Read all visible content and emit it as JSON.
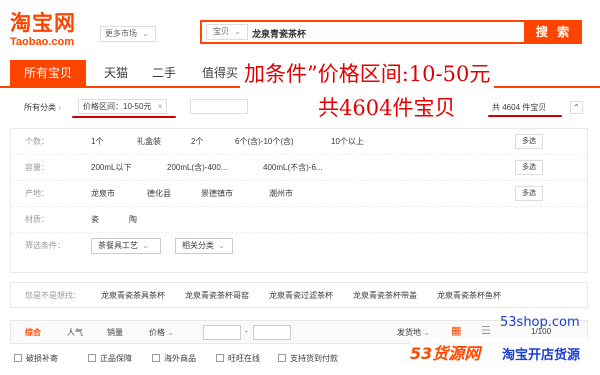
{
  "header": {
    "logo_cn": "淘宝网",
    "logo_en": "Taobao.com",
    "more_market": "更多市场",
    "search_category": "宝贝",
    "search_value": "龙泉青瓷茶杯",
    "search_button": "搜 索"
  },
  "tabs": [
    "所有宝贝",
    "天猫",
    "二手",
    "值得买"
  ],
  "overlay": {
    "line1": "加条件”价格区间:10-50元",
    "line2": "共4604件宝贝"
  },
  "breadcrumb": {
    "root": "所有分类",
    "price_tag": "价格区间：10-50元",
    "close": "×",
    "result_count": "共 4604 件宝贝"
  },
  "filters": [
    {
      "label": "个数：",
      "options": [
        "1个",
        "礼盒装",
        "2个",
        "6个(含)-10个(含)",
        "10个以上"
      ],
      "multi": "多选"
    },
    {
      "label": "容量：",
      "options": [
        "200mL以下",
        "200mL(含)-400...",
        "400mL(不含)-6..."
      ],
      "multi": "多选"
    },
    {
      "label": "产地：",
      "options": [
        "龙泉市",
        "德化县",
        "景德镇市",
        "潮州市"
      ],
      "multi": "多选"
    },
    {
      "label": "材质：",
      "options": [
        "瓷",
        "陶"
      ],
      "multi": ""
    },
    {
      "label": "筛选条件：",
      "options": [
        "茶餐具工艺",
        "相关分类"
      ],
      "multi": ""
    }
  ],
  "suggestions": {
    "label": "您是不是想找：",
    "items": [
      "龙泉青瓷茶具茶杯",
      "龙泉青瓷茶杯哥窑",
      "龙泉青瓷过滤茶杯",
      "龙泉青瓷茶杯带盖",
      "龙泉青瓷茶杯鱼杯"
    ]
  },
  "sort": {
    "items": [
      "综合",
      "人气",
      "销量",
      "价格"
    ],
    "dash": "-",
    "ship_to": "发货地",
    "page": "1/100"
  },
  "checks": [
    "破损补寄",
    "正品保障",
    "海外商品",
    "旺旺在线",
    "支持货到付款"
  ],
  "watermark": {
    "url": "53shop.com",
    "brand": "53货源网",
    "slogan": "淘宝开店货源"
  },
  "colors": {
    "accent": "#ff4400",
    "overlay_red": "#e30000",
    "watermark_blue": "#1a3fd4"
  }
}
